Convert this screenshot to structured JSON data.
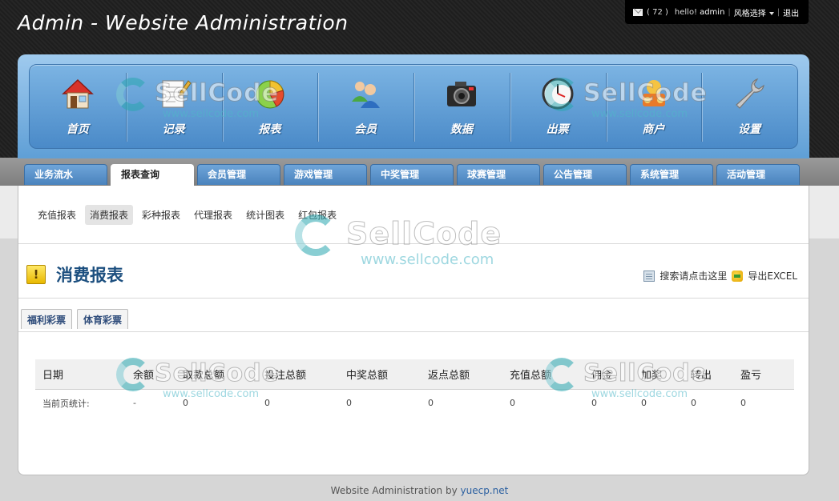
{
  "site": {
    "title": "Admin - Website Administration"
  },
  "userbar": {
    "message_count": "( 72 )",
    "greeting": "hello!",
    "username": "admin",
    "style_select": "风格选择",
    "logout": "退出"
  },
  "nav": {
    "items": [
      {
        "label": "首页",
        "icon": "home-icon"
      },
      {
        "label": "记录",
        "icon": "notepad-icon"
      },
      {
        "label": "报表",
        "icon": "pie-chart-icon"
      },
      {
        "label": "会员",
        "icon": "users-icon"
      },
      {
        "label": "数据",
        "icon": "camera-icon"
      },
      {
        "label": "出票",
        "icon": "clock-icon"
      },
      {
        "label": "商户",
        "icon": "merchant-icon"
      },
      {
        "label": "设置",
        "icon": "wrench-icon"
      }
    ]
  },
  "tabs": [
    {
      "label": "业务流水"
    },
    {
      "label": "报表查询"
    },
    {
      "label": "会员管理"
    },
    {
      "label": "游戏管理"
    },
    {
      "label": "中奖管理"
    },
    {
      "label": "球赛管理"
    },
    {
      "label": "公告管理"
    },
    {
      "label": "系统管理"
    },
    {
      "label": "活动管理"
    }
  ],
  "active_tab": "报表查询",
  "subnav": [
    {
      "label": "充值报表"
    },
    {
      "label": "消费报表"
    },
    {
      "label": "彩种报表"
    },
    {
      "label": "代理报表"
    },
    {
      "label": "统计图表"
    },
    {
      "label": "红包报表"
    }
  ],
  "active_subnav": "消费报表",
  "page": {
    "title": "消费报表",
    "search_link": "搜索请点击这里",
    "export_link": "导出EXCEL",
    "colors": {
      "title": "#1c4f7f",
      "nav_blue": "#4a83bd"
    }
  },
  "lottery_tabs": [
    {
      "label": "福利彩票"
    },
    {
      "label": "体育彩票"
    }
  ],
  "table": {
    "columns": [
      "日期",
      "余额",
      "取款总额",
      "投注总额",
      "中奖总额",
      "返点总额",
      "充值总额",
      "佣金",
      "加奖",
      "转出",
      "盈亏"
    ],
    "rows": [
      [
        "当前页统计:",
        "-",
        "0",
        "0",
        "0",
        "0",
        "0",
        "0",
        "0",
        "0",
        "0"
      ]
    ]
  },
  "footer": {
    "text": "Website Administration by",
    "link": "yuecp.net"
  },
  "watermark": {
    "brand": "SellCode",
    "url": "www.sellcode.com"
  }
}
